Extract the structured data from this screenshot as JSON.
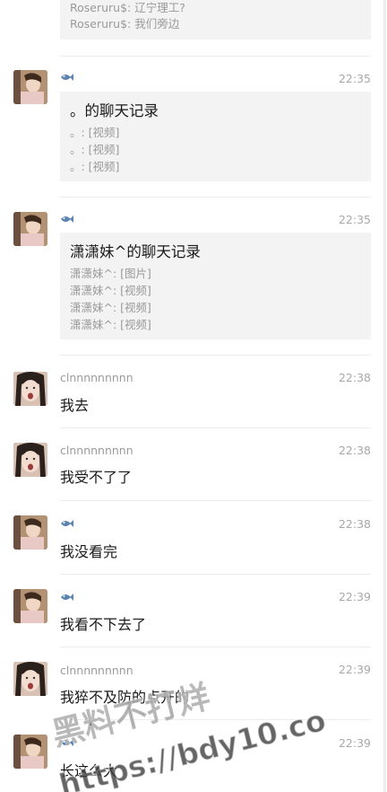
{
  "top_record": {
    "lines": [
      "Roseruru$: 辽宁理工?",
      "Roseruru$: 我们旁边"
    ]
  },
  "messages": [
    {
      "sender": "",
      "avatar": "kid-photo",
      "time": "22:35",
      "type": "record",
      "record": {
        "title": "。的聊天记录",
        "lines": [
          "。: [视频]",
          "。: [视频]",
          "。: [视频]"
        ]
      }
    },
    {
      "sender": "",
      "avatar": "kid-photo",
      "time": "22:35",
      "type": "record",
      "record": {
        "title": "潇潇妹^的聊天记录",
        "lines": [
          "潇潇妹^: [图片]",
          "潇潇妹^: [视频]",
          "潇潇妹^: [视频]",
          "潇潇妹^: [视频]"
        ]
      }
    },
    {
      "sender": "clnnnnnnnnn",
      "avatar": "girl-photo",
      "time": "22:38",
      "type": "text",
      "text": "我去"
    },
    {
      "sender": "clnnnnnnnnn",
      "avatar": "girl-photo",
      "time": "22:38",
      "type": "text",
      "text": "我受不了了"
    },
    {
      "sender": "",
      "avatar": "kid-photo",
      "time": "22:38",
      "type": "text",
      "text": "我没看完"
    },
    {
      "sender": "",
      "avatar": "kid-photo",
      "time": "22:39",
      "type": "text",
      "text": "我看不下去了"
    },
    {
      "sender": "clnnnnnnnnn",
      "avatar": "girl-photo",
      "time": "22:39",
      "type": "text",
      "text": "我猝不及防的点开的"
    },
    {
      "sender": "",
      "avatar": "kid-photo",
      "time": "22:39",
      "type": "text",
      "text": "长这么大"
    }
  ],
  "watermark": {
    "line1": "黑料不打烊",
    "line2": "https://bdy10.co"
  },
  "colors": {
    "card_bg": "#f3f3f3",
    "meta_text": "#9b9b9b",
    "watermark": "#3a3a3a"
  }
}
